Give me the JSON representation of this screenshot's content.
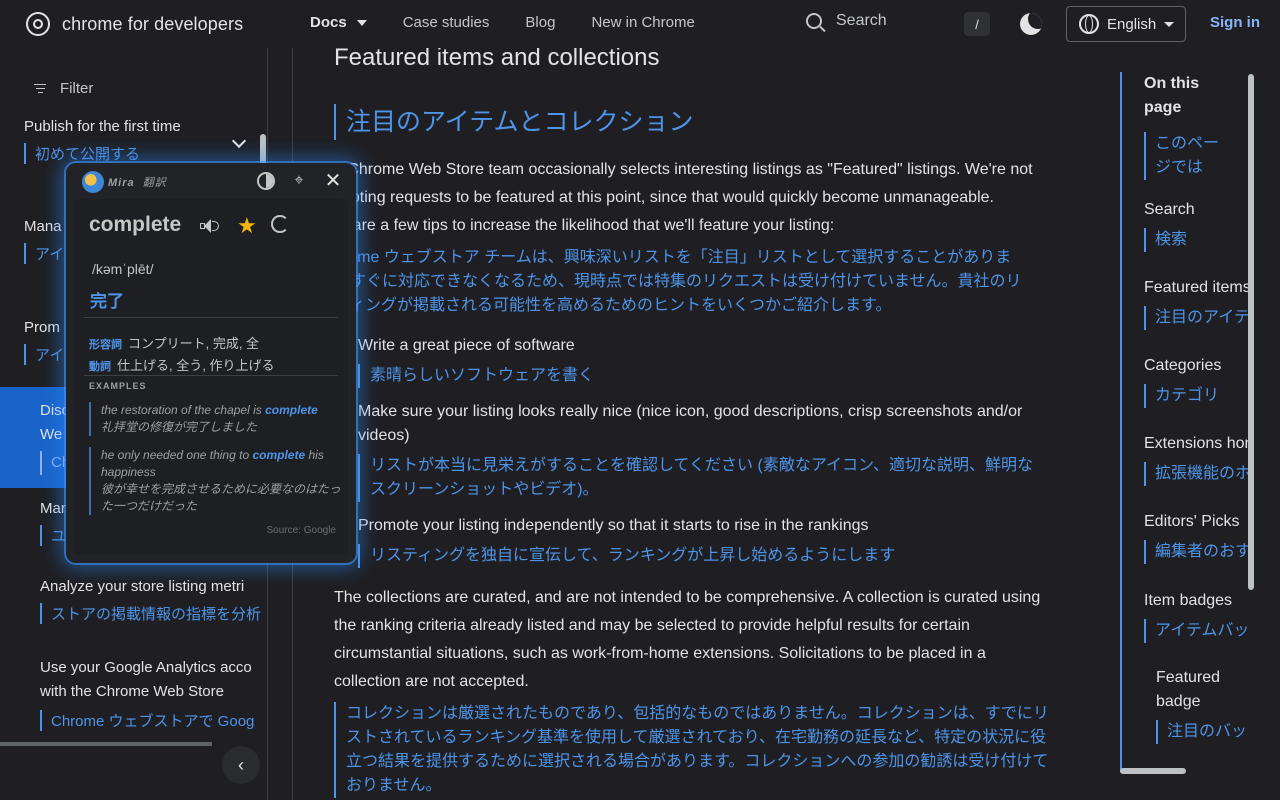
{
  "header": {
    "brand": "chrome for developers",
    "nav": [
      {
        "label": "Docs"
      },
      {
        "label": "Case studies"
      },
      {
        "label": "Blog"
      },
      {
        "label": "New in Chrome"
      }
    ],
    "search_label": "Search",
    "search_shortcut": "/",
    "language": "English",
    "signin": "Sign in"
  },
  "sidebar": {
    "filter_label": "Filter",
    "items": [
      {
        "en": "Publish for the first time",
        "jp": "初めて公開する"
      },
      {
        "en": "Mana",
        "jp": "アイ"
      },
      {
        "en": "Prom",
        "jp": "アイ"
      },
      {
        "en": "Disc",
        "en2": "We",
        "jp": "Ch"
      },
      {
        "en": "Man",
        "jp": "ユ"
      },
      {
        "en": "Analyze your store listing metri",
        "jp": "ストアの掲載情報の指標を分析"
      },
      {
        "en": "Use your Google Analytics acco",
        "en2": "with the Chrome Web Store",
        "jp": "Chrome ウェブストアで Goog"
      }
    ]
  },
  "main": {
    "heading_en": "Featured items and collections",
    "heading_jp": "注目のアイテムとコレクション",
    "intro_en": [
      "e Chrome Web Store team occasionally selects interesting listings as \"Featured\" listings. We're not",
      "cepting requests to be featured at this point, since that would quickly become unmanageable.",
      "re are a few tips to increase the likelihood that we'll feature your listing:"
    ],
    "intro_jp": [
      "hrome ウェブストア チームは、興味深いリストを「注目」リストとして選択することがありま",
      "。すぐに対応できなくなるため、現時点では特集のリクエストは受け付けていません。貴社のリ",
      "ティングが掲載される可能性を高めるためのヒントをいくつかご紹介します。"
    ],
    "bullets": [
      {
        "en": "Write a great piece of software",
        "jp": "素晴らしいソフトウェアを書く"
      },
      {
        "en": "Make sure your listing looks really nice (nice icon, good descriptions, crisp screenshots and/or videos)",
        "jp": "リストが本当に見栄えがすることを確認してください (素敵なアイコン、適切な説明、鮮明なスクリーンショットやビデオ)。"
      },
      {
        "en": "Promote your listing independently so that it starts to rise in the rankings",
        "jp": "リスティングを独自に宣伝して、ランキングが上昇し始めるようにします"
      }
    ],
    "collections_en": "The collections are curated, and are not intended to be comprehensive. A collection is curated using the ranking criteria already listed and may be selected to provide helpful results for certain circumstantial situations, such as work-from-home extensions. Solicitations to be placed in a collection are not accepted.",
    "collections_jp": "コレクションは厳選されたものであり、包括的なものではありません。コレクションは、すでにリストされているランキング基準を使用して厳選されており、在宅勤務の延長など、特定の状況に役立つ結果を提供するために選択される場合があります。コレクションへの参加の勧誘は受け付けておりません。"
  },
  "toc": {
    "title": "On this page",
    "title_jp": "このページでは",
    "items": [
      {
        "en": "Search",
        "jp": "検索"
      },
      {
        "en": "Featured items",
        "jp": "注目のアイテ"
      },
      {
        "en": "Categories",
        "jp": "カテゴリ"
      },
      {
        "en": "Extensions hon",
        "jp": "拡張機能のホ"
      },
      {
        "en": "Editors' Picks",
        "jp": "編集者のおす"
      },
      {
        "en": "Item badges",
        "jp": "アイテムバッ"
      },
      {
        "en": "Featured badge",
        "jp": "注目のバッ"
      }
    ]
  },
  "popup": {
    "app_name": "Mira",
    "app_sub": "翻訳",
    "word": "complete",
    "phonetic": "/kəmˈplēt/",
    "translation": "完了",
    "pos": [
      {
        "tag": "形容詞",
        "text": "コンプリート, 完成, 全"
      },
      {
        "tag": "動詞",
        "text": "仕上げる, 全う, 作り上げる"
      }
    ],
    "examples_label": "EXAMPLES",
    "examples": [
      {
        "pre": "the restoration of the chapel is ",
        "hl": "complete",
        "post": "",
        "jp": "礼拝堂の修復が完了しました"
      },
      {
        "pre": "he only needed one thing to ",
        "hl": "complete",
        "post": " his happiness",
        "jp": "彼が幸せを完成させるために必要なのはたった一つだけだった"
      }
    ],
    "source": "Source: Google"
  },
  "colors": {
    "background": "#1f1f23",
    "accent_blue": "#4e94e8",
    "active_sidebar": "#1a63c9",
    "star": "#f2b50f"
  }
}
